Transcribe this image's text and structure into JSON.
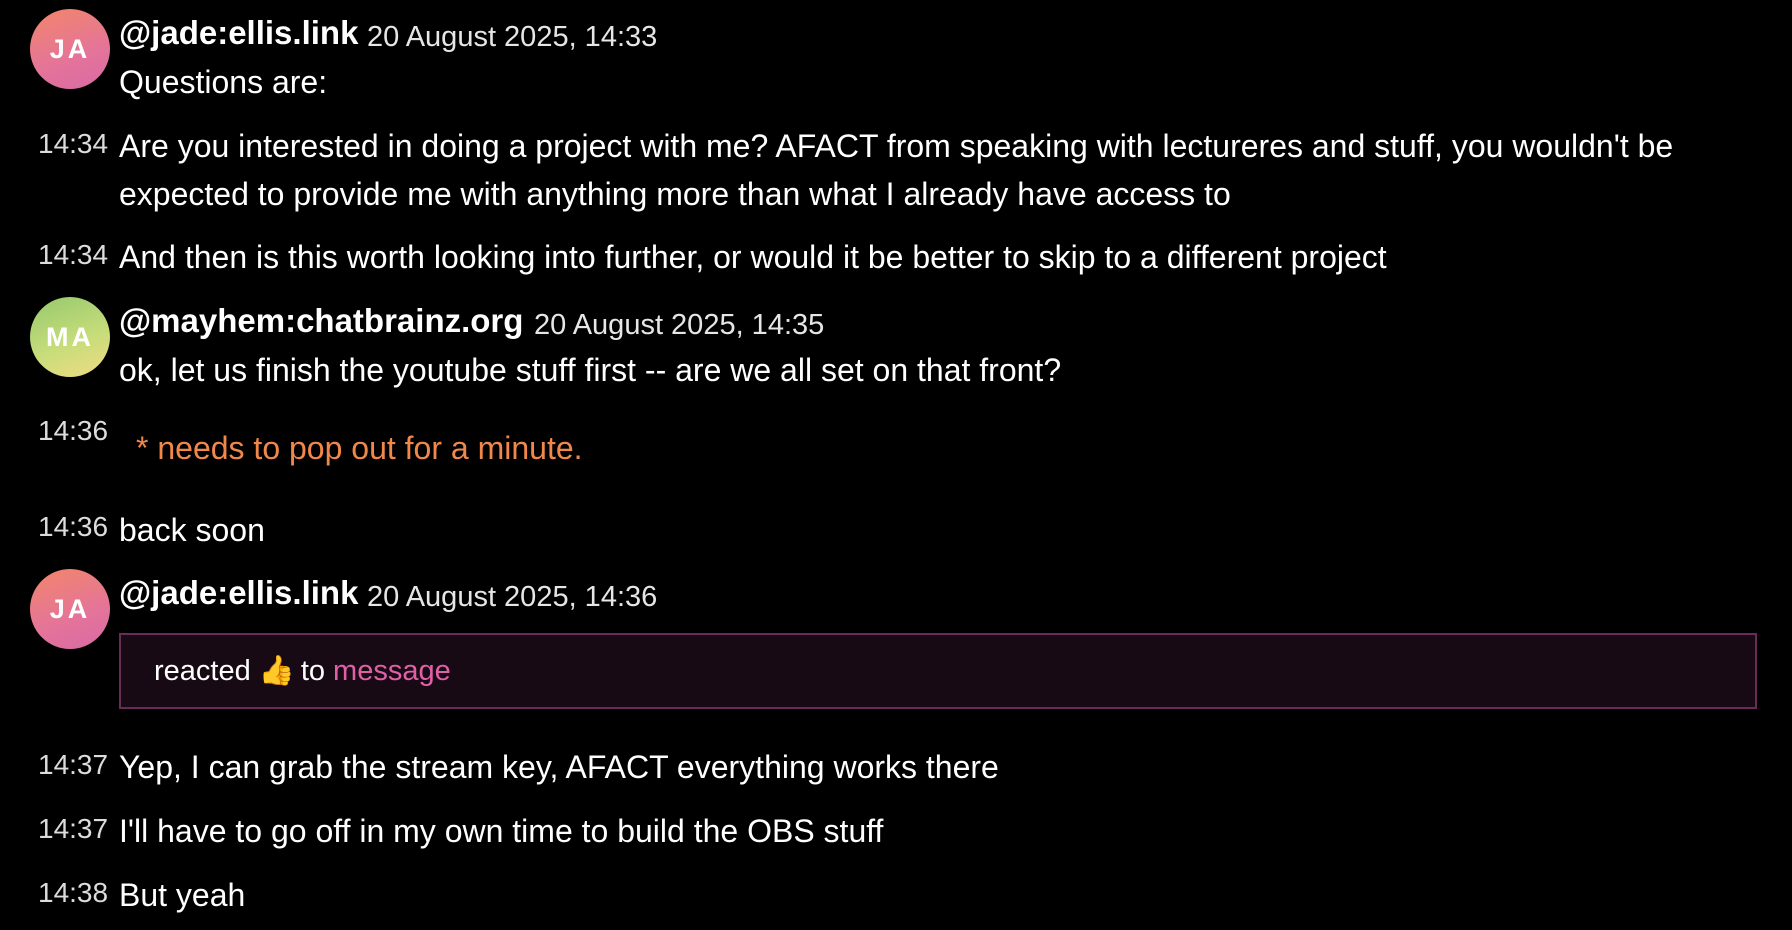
{
  "timeline": {
    "group1": {
      "avatar_initials": "JA",
      "sender": "@jade:ellis.link",
      "date": "20 August 2025, 14:33",
      "first_message": "Questions are:",
      "messages": [
        {
          "time": "14:34",
          "text": "Are you interested in doing a project with me? AFACT from speaking with lectureres and stuff, you wouldn't be expected to provide me with anything more than what I already have access to"
        },
        {
          "time": "14:34",
          "text": "And then is this worth looking into further, or would it be better to skip to a different project"
        }
      ]
    },
    "group2": {
      "avatar_initials": "MA",
      "sender": "@mayhem:chatbrainz.org",
      "date": "20 August 2025, 14:35",
      "first_message": "ok, let us finish the youtube stuff first -- are we all set on that front?",
      "messages": [
        {
          "time": "14:36",
          "text": "* needs to pop out for a minute."
        },
        {
          "time": "14:36",
          "text": "back soon"
        }
      ]
    },
    "group3": {
      "avatar_initials": "JA",
      "sender": "@jade:ellis.link",
      "date": "20 August 2025, 14:36",
      "reaction": {
        "prefix": "reacted",
        "emoji": "👍",
        "middle": "to",
        "link_text": "message"
      },
      "messages": [
        {
          "time": "14:37",
          "text": "Yep, I can grab the stream key, AFACT everything works there"
        },
        {
          "time": "14:37",
          "text": "I'll have to go off in my own time to build the OBS stuff"
        },
        {
          "time": "14:38",
          "text": "But yeah"
        }
      ]
    }
  },
  "colors": {
    "background": "#000000",
    "emote_text": "#f0884b",
    "reaction_link": "#e060a8",
    "reaction_border": "#6a2b55"
  }
}
